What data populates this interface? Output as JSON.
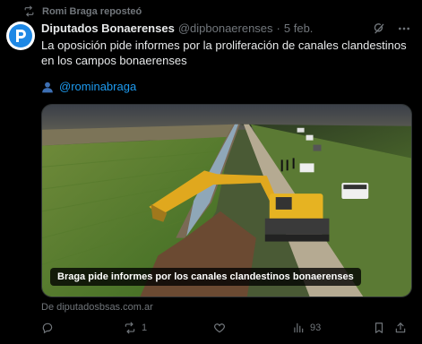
{
  "repost": {
    "label": "Romi Braga reposteó",
    "icon": "repost-icon"
  },
  "author": {
    "display_name": "Diputados Bonaerenses",
    "handle": "@dipbonaerenses",
    "separator": "·",
    "date": "5 feb.",
    "avatar_icon": "diputados-logo-icon",
    "avatar_color": "#1e88e5"
  },
  "tweet": {
    "text": "La oposición pide informes por la proliferación de canales clandestinos en los campos bonaerenses",
    "mention": "@rominabraga",
    "mention_icon": "person-silhouette-icon"
  },
  "media": {
    "caption": "Braga pide informes por los canales clandestinos bonaerenses",
    "source": "De diputadosbsas.com.ar"
  },
  "actions": {
    "reply_count": "",
    "repost_count": "1",
    "like_count": "",
    "views_count": "93"
  },
  "colors": {
    "accent": "#1d9bf0",
    "muted": "#71767b",
    "background": "#000000"
  }
}
